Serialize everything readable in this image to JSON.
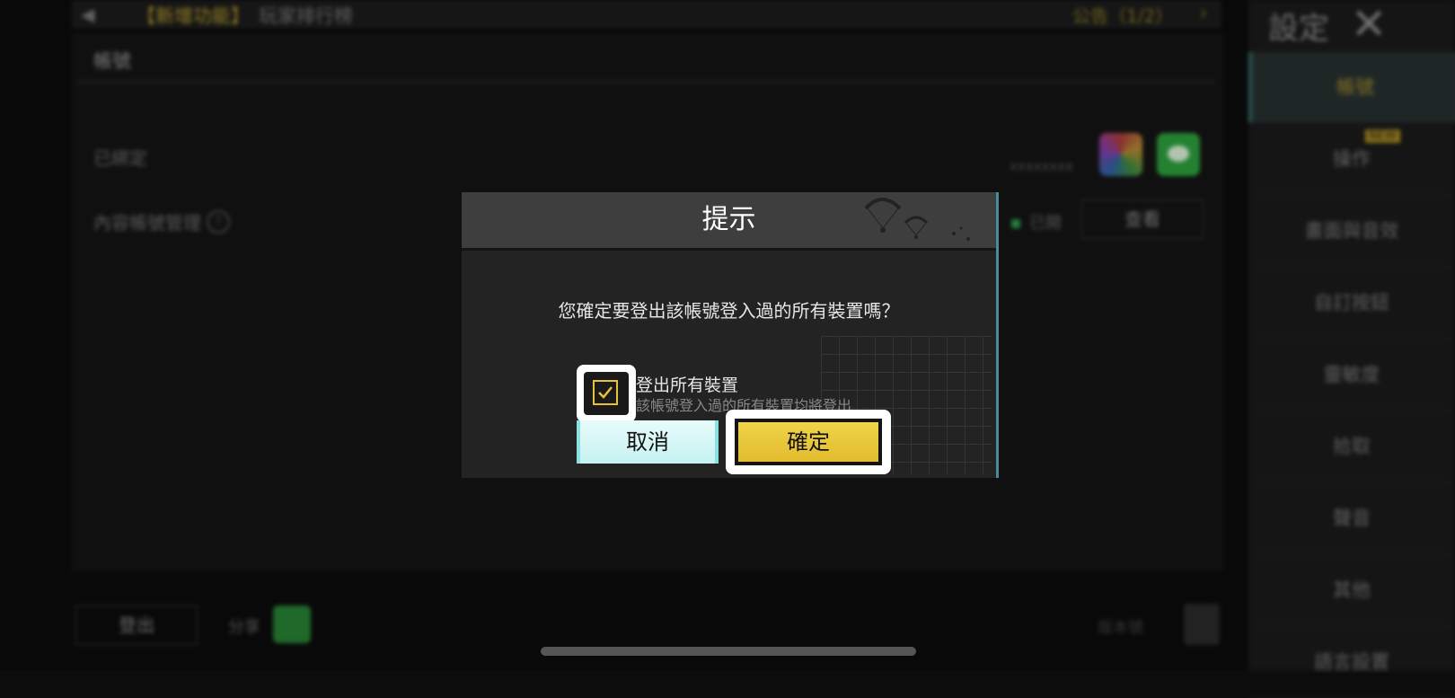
{
  "background": {
    "notice_tag": "【新增功能】",
    "notice_text": "玩家排行榜",
    "notice_count": "公告（1/2）",
    "section_label": "帳號",
    "bound_label": "已綁定",
    "bound_id": "xxxxxxxx",
    "content_label": "內容帳號管理",
    "enable_label": "已開",
    "view_button": "查看",
    "bottom_button": "登出",
    "share_label": "分享",
    "version": "版本號"
  },
  "sidebar": {
    "title": "設定",
    "new_badge": "NEW",
    "items": [
      {
        "label": "帳號",
        "active": true
      },
      {
        "label": "操作"
      },
      {
        "label": "畫面與音效"
      },
      {
        "label": "自訂按鈕"
      },
      {
        "label": "靈敏度"
      },
      {
        "label": "拾取"
      },
      {
        "label": "聲音"
      },
      {
        "label": "其他"
      },
      {
        "label": "語言設置"
      }
    ]
  },
  "dialog": {
    "title": "提示",
    "message": "您確定要登出該帳號登入過的所有裝置嗎？",
    "checkbox_label": "登出所有裝置",
    "checkbox_checked": true,
    "checkbox_desc": "該帳號登入過的所有裝置均將登出",
    "cancel_label": "取消",
    "confirm_label": "確定"
  },
  "colors": {
    "confirm_yellow": "#e8c33a",
    "cancel_cyan": "#c6f2f2",
    "highlight": "#ffffff"
  },
  "icons": [
    "back-icon",
    "close-icon",
    "game-center-icon",
    "line-app-icon",
    "help-icon",
    "parachute-icon",
    "checkmark-icon"
  ]
}
